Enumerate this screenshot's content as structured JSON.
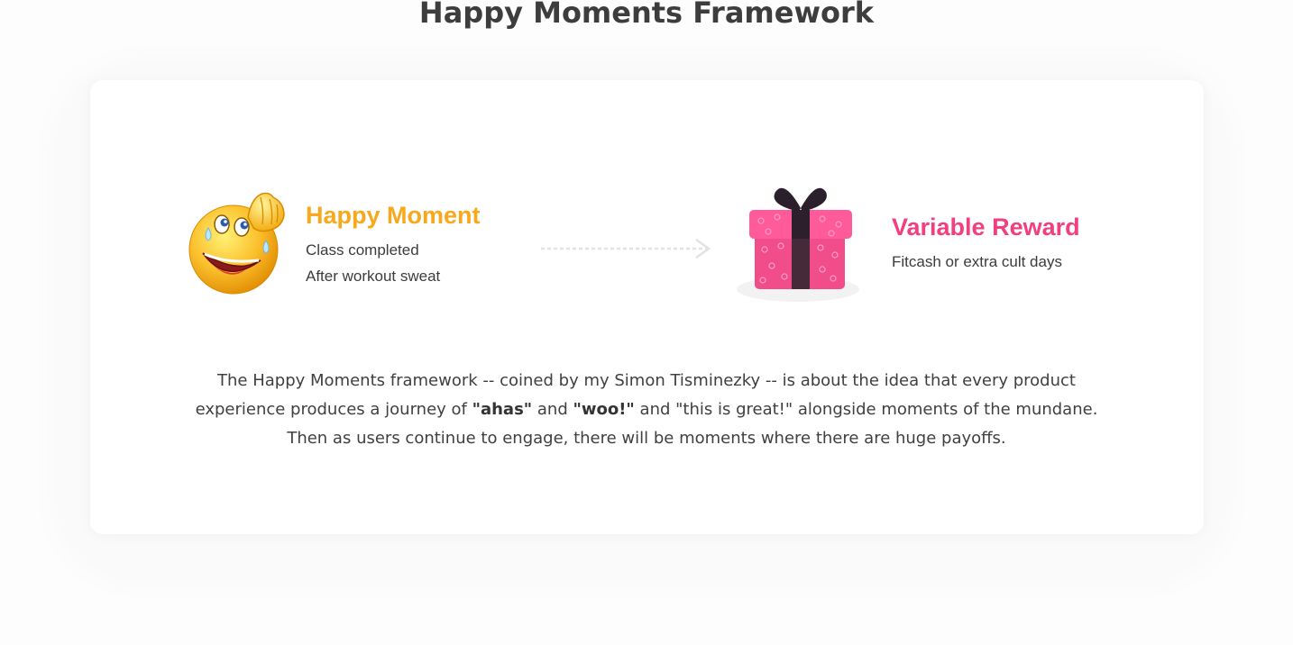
{
  "page": {
    "title": "Happy Moments Framework"
  },
  "happy_moment": {
    "icon": "sweating-emoji-icon",
    "title": "Happy Moment",
    "lines": [
      "Class completed",
      "After workout sweat"
    ],
    "color": "#f7a81c"
  },
  "arrow": {
    "icon": "dashed-arrow-right-icon"
  },
  "variable_reward": {
    "icon": "gift-box-icon",
    "title": "Variable Reward",
    "lines": [
      "Fitcash or extra cult days"
    ],
    "color": "#f23f80"
  },
  "description": {
    "part1": "The Happy Moments framework -- coined by my Simon Tisminezky -- is about the idea that every product experience produces a journey of ",
    "bold1": "\"ahas\"",
    "part2": " and ",
    "bold2": "\"woo!\"",
    "part3": " and \"this is great!\" alongside moments of the mundane. Then as users continue to engage, there will be moments where there are huge payoffs."
  }
}
